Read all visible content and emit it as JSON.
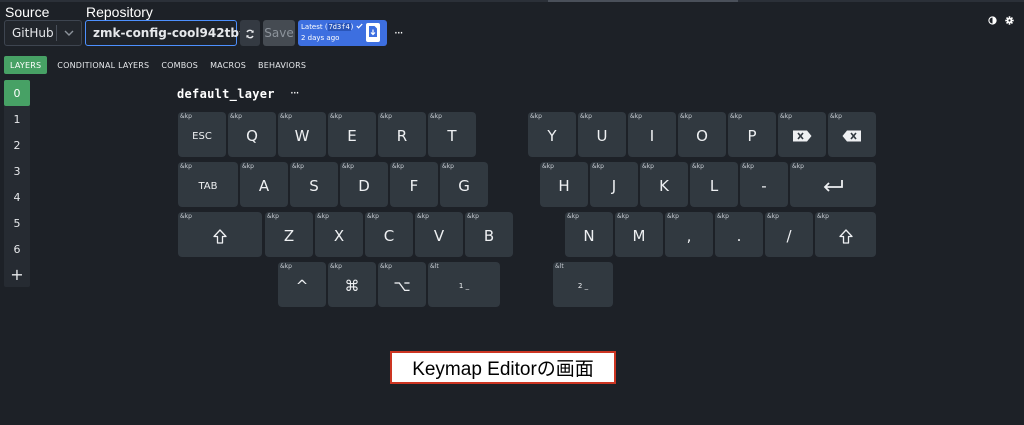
{
  "header": {
    "source_label": "Source",
    "repository_label": "Repository",
    "source_value": "GitHub",
    "repository_value": "zmk-config-cool942tb",
    "save_label": "Save",
    "commit": {
      "prefix": "Latest (",
      "hash": "7d3f4",
      "suffix": ")",
      "time": "2 days ago"
    },
    "more": "···"
  },
  "tabs": [
    {
      "label": "LAYERS",
      "active": true
    },
    {
      "label": "CONDITIONAL LAYERS",
      "active": false
    },
    {
      "label": "COMBOS",
      "active": false
    },
    {
      "label": "MACROS",
      "active": false
    },
    {
      "label": "BEHAVIORS",
      "active": false
    }
  ],
  "layers": [
    "0",
    "1",
    "2",
    "3",
    "4",
    "5",
    "6"
  ],
  "layer_add": "+",
  "active_layer": "0",
  "layer_title": "default_layer",
  "layer_more": "···",
  "keys": [
    {
      "b": "&kp",
      "l": "ESC",
      "s": "small"
    },
    {
      "b": "&kp",
      "l": "Q"
    },
    {
      "b": "&kp",
      "l": "W"
    },
    {
      "b": "&kp",
      "l": "E"
    },
    {
      "b": "&kp",
      "l": "R"
    },
    {
      "b": "&kp",
      "l": "T"
    },
    {
      "b": "&kp",
      "l": "Y"
    },
    {
      "b": "&kp",
      "l": "U"
    },
    {
      "b": "&kp",
      "l": "I"
    },
    {
      "b": "&kp",
      "l": "O"
    },
    {
      "b": "&kp",
      "l": "P"
    },
    {
      "b": "&kp",
      "l": "",
      "icon": "delete-forward-icon"
    },
    {
      "b": "&kp",
      "l": "",
      "icon": "backspace-icon"
    },
    {
      "b": "&kp",
      "l": "TAB",
      "s": "small"
    },
    {
      "b": "&kp",
      "l": "A"
    },
    {
      "b": "&kp",
      "l": "S"
    },
    {
      "b": "&kp",
      "l": "D"
    },
    {
      "b": "&kp",
      "l": "F"
    },
    {
      "b": "&kp",
      "l": "G"
    },
    {
      "b": "&kp",
      "l": "H"
    },
    {
      "b": "&kp",
      "l": "J"
    },
    {
      "b": "&kp",
      "l": "K"
    },
    {
      "b": "&kp",
      "l": "L"
    },
    {
      "b": "&kp",
      "l": "-"
    },
    {
      "b": "&kp",
      "l": "",
      "icon": "return-icon"
    },
    {
      "b": "&kp",
      "l": "",
      "icon": "shift-icon"
    },
    {
      "b": "&kp",
      "l": "Z"
    },
    {
      "b": "&kp",
      "l": "X"
    },
    {
      "b": "&kp",
      "l": "C"
    },
    {
      "b": "&kp",
      "l": "V"
    },
    {
      "b": "&kp",
      "l": "B"
    },
    {
      "b": "&kp",
      "l": "N"
    },
    {
      "b": "&kp",
      "l": "M"
    },
    {
      "b": "&kp",
      "l": ","
    },
    {
      "b": "&kp",
      "l": "."
    },
    {
      "b": "&kp",
      "l": "/"
    },
    {
      "b": "&kp",
      "l": "",
      "icon": "shift-icon"
    },
    {
      "b": "&kp",
      "l": "^"
    },
    {
      "b": "&kp",
      "l": "⌘"
    },
    {
      "b": "&kp",
      "l": "⌥"
    },
    {
      "b": "&lt",
      "l": "1 _",
      "s": "tiny"
    },
    {
      "b": "&lt",
      "l": "2 _",
      "s": "tiny"
    }
  ],
  "caption": "Keymap Editorの画面"
}
